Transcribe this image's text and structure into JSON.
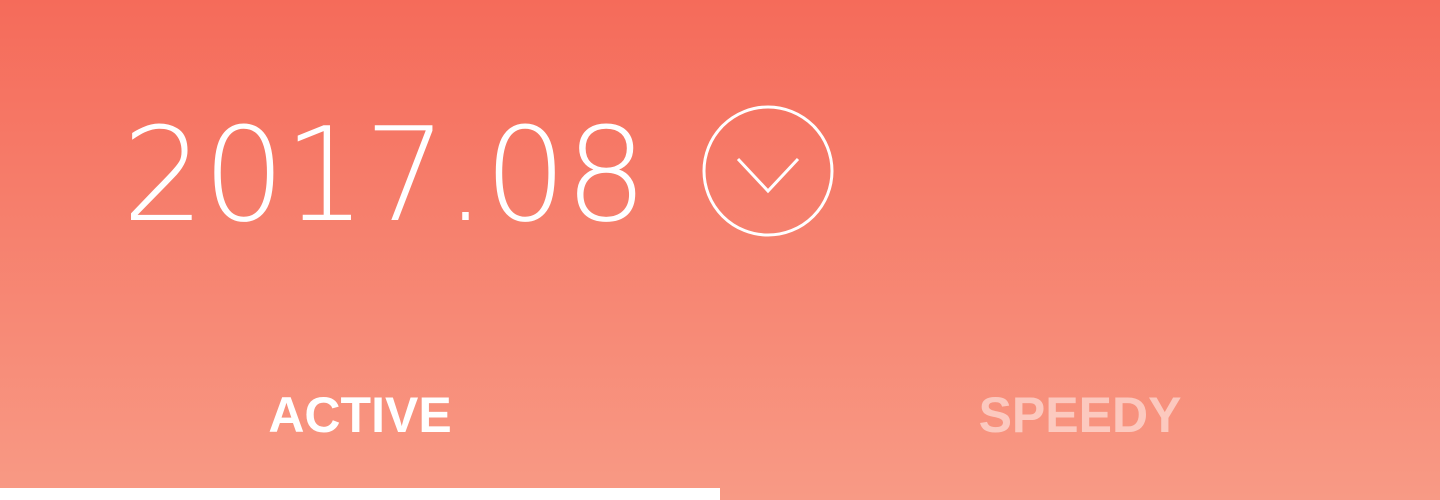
{
  "header": {
    "date_label": "2017.08",
    "date_picker_icon": "chevron-down-circle-icon"
  },
  "tabs": [
    {
      "label": "ACTIVE",
      "selected": true
    },
    {
      "label": "SPEEDY",
      "selected": false
    }
  ],
  "colors": {
    "background_top": "#f56b5a",
    "background_bottom": "#f89a85",
    "foreground": "#ffffff"
  }
}
